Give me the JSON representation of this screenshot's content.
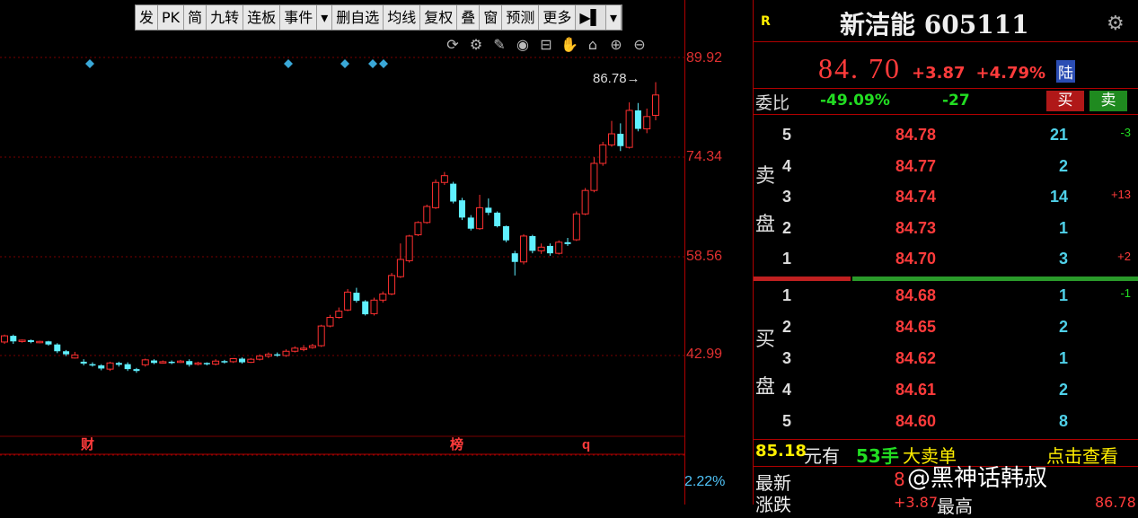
{
  "toolbar": {
    "items": [
      "发",
      "PK",
      "简",
      "九转",
      "连板",
      "事件",
      "▾",
      "删自选",
      "均线",
      "复权",
      "叠",
      "窗",
      "预测",
      "更多",
      "▶▌",
      "▾"
    ]
  },
  "chart_icons": [
    "refresh-icon",
    "gear-icon",
    "pen-icon",
    "eye-icon",
    "lock-icon",
    "hand-icon",
    "lock-icon",
    "zoom-in-icon",
    "zoom-out-icon"
  ],
  "chart": {
    "y_labels": [
      "89.92",
      "74.34",
      "58.56",
      "42.99"
    ],
    "high_label": "86.78",
    "event_markers": [
      "财",
      "榜",
      "q"
    ],
    "volume_pct": "2.22%"
  },
  "chart_data": {
    "type": "candlestick",
    "ylim": [
      30,
      95
    ],
    "candles": [
      [
        44.6,
        45.6,
        44.3,
        45.8
      ],
      [
        45.6,
        44.7,
        44.3,
        45.8
      ],
      [
        44.7,
        44.9,
        44.5,
        45.0
      ],
      [
        44.9,
        44.6,
        44.4,
        45.0
      ],
      [
        44.6,
        44.7,
        44.4,
        44.8
      ],
      [
        44.7,
        44.2,
        44.0,
        44.8
      ],
      [
        44.2,
        43.1,
        42.8,
        44.4
      ],
      [
        43.1,
        42.6,
        42.3,
        43.3
      ],
      [
        42.0,
        42.5,
        41.9,
        43.0
      ],
      [
        41.4,
        41.1,
        40.8,
        41.8
      ],
      [
        41.0,
        40.9,
        40.6,
        41.3
      ],
      [
        40.8,
        40.3,
        40.0,
        41.0
      ],
      [
        40.2,
        41.2,
        39.9,
        41.4
      ],
      [
        41.2,
        40.9,
        40.6,
        41.4
      ],
      [
        41.0,
        40.2,
        39.9,
        41.3
      ],
      [
        40.2,
        39.9,
        39.6,
        40.4
      ],
      [
        40.9,
        41.7,
        40.6,
        41.9
      ],
      [
        41.6,
        41.2,
        41.0,
        41.8
      ],
      [
        41.3,
        41.4,
        41.1,
        41.6
      ],
      [
        41.4,
        41.3,
        41.0,
        41.6
      ],
      [
        41.3,
        41.5,
        41.2,
        41.7
      ],
      [
        41.5,
        40.9,
        40.6,
        41.8
      ],
      [
        41.0,
        41.2,
        40.8,
        41.4
      ],
      [
        41.2,
        41.0,
        40.8,
        41.3
      ],
      [
        41.0,
        41.5,
        40.8,
        41.8
      ],
      [
        41.5,
        41.4,
        41.1,
        41.7
      ],
      [
        41.4,
        41.9,
        41.2,
        42.0
      ],
      [
        41.9,
        41.3,
        41.1,
        42.1
      ],
      [
        41.3,
        41.8,
        41.2,
        42.0
      ],
      [
        41.8,
        42.3,
        41.6,
        42.6
      ],
      [
        42.3,
        42.6,
        42.0,
        42.9
      ],
      [
        42.6,
        42.4,
        42.2,
        42.9
      ],
      [
        42.4,
        43.1,
        42.2,
        43.4
      ],
      [
        43.1,
        43.6,
        42.9,
        43.9
      ],
      [
        43.4,
        43.6,
        43.1,
        44.1
      ],
      [
        43.7,
        44.0,
        43.5,
        44.3
      ],
      [
        44.0,
        47.2,
        43.8,
        47.4
      ],
      [
        47.2,
        48.6,
        47.0,
        49.0
      ],
      [
        48.6,
        49.6,
        48.4,
        50.2
      ],
      [
        49.8,
        52.7,
        49.6,
        53.2
      ],
      [
        52.6,
        51.3,
        51.0,
        53.4
      ],
      [
        51.2,
        49.1,
        48.9,
        51.4
      ],
      [
        49.2,
        51.4,
        48.9,
        51.8
      ],
      [
        51.4,
        52.4,
        51.0,
        52.8
      ],
      [
        52.4,
        55.4,
        52.2,
        55.8
      ],
      [
        55.2,
        58.0,
        55.0,
        60.6
      ],
      [
        57.8,
        61.8,
        57.5,
        62.0
      ],
      [
        62.0,
        64.0,
        61.8,
        64.2
      ],
      [
        64.0,
        66.6,
        63.8,
        66.9
      ],
      [
        66.4,
        70.5,
        66.2,
        71.0
      ],
      [
        70.5,
        71.6,
        70.1,
        72.2
      ],
      [
        70.3,
        67.4,
        67.1,
        70.6
      ],
      [
        67.6,
        64.8,
        64.4,
        68.0
      ],
      [
        64.8,
        63.0,
        62.7,
        65.2
      ],
      [
        63.0,
        66.4,
        62.8,
        68.5
      ],
      [
        66.4,
        65.6,
        65.2,
        67.9
      ],
      [
        65.6,
        63.4,
        63.2,
        65.8
      ],
      [
        63.4,
        61.1,
        60.8,
        63.5
      ],
      [
        59.0,
        57.6,
        55.4,
        59.4
      ],
      [
        57.6,
        61.8,
        57.2,
        62.1
      ],
      [
        61.8,
        59.4,
        59.0,
        62.0
      ],
      [
        59.4,
        60.0,
        58.9,
        60.6
      ],
      [
        60.2,
        59.0,
        58.6,
        60.6
      ],
      [
        59.0,
        60.8,
        58.8,
        61.1
      ],
      [
        60.8,
        60.5,
        60.2,
        61.5
      ],
      [
        61.2,
        65.4,
        61.0,
        65.8
      ],
      [
        65.4,
        69.2,
        65.2,
        69.6
      ],
      [
        69.2,
        73.6,
        68.9,
        74.6
      ],
      [
        73.6,
        76.6,
        73.2,
        77.1
      ],
      [
        76.6,
        78.4,
        76.3,
        80.5
      ],
      [
        78.4,
        76.4,
        75.6,
        80.1
      ],
      [
        76.2,
        82.2,
        76.0,
        83.5
      ],
      [
        82.2,
        79.2,
        78.8,
        83.4
      ],
      [
        79.2,
        81.2,
        78.5,
        82.5
      ],
      [
        81.4,
        84.7,
        80.6,
        86.78
      ]
    ]
  },
  "quote": {
    "badge": "R",
    "name": "新洁能 605111",
    "price": "84. 70",
    "change": "+3.87",
    "change_pct": "+4.79%",
    "market": "陆"
  },
  "webi": {
    "label": "委比",
    "ratio": "-49.09%",
    "diff": "-27",
    "buy_label": "买",
    "sell_label": "卖"
  },
  "sell_side": {
    "label1": "卖",
    "label2": "盘",
    "rows": [
      {
        "lvl": "5",
        "price": "84.78",
        "vol": "21",
        "d": "-3",
        "dc": "green"
      },
      {
        "lvl": "4",
        "price": "84.77",
        "vol": "2",
        "d": "",
        "dc": ""
      },
      {
        "lvl": "3",
        "price": "84.74",
        "vol": "14",
        "d": "+13",
        "dc": "red"
      },
      {
        "lvl": "2",
        "price": "84.73",
        "vol": "1",
        "d": "",
        "dc": ""
      },
      {
        "lvl": "1",
        "price": "84.70",
        "vol": "3",
        "d": "+2",
        "dc": "red"
      }
    ]
  },
  "buy_side": {
    "label1": "买",
    "label2": "盘",
    "rows": [
      {
        "lvl": "1",
        "price": "84.68",
        "vol": "1",
        "d": "-1",
        "dc": "green"
      },
      {
        "lvl": "2",
        "price": "84.65",
        "vol": "2",
        "d": "",
        "dc": ""
      },
      {
        "lvl": "3",
        "price": "84.62",
        "vol": "1",
        "d": "",
        "dc": ""
      },
      {
        "lvl": "4",
        "price": "84.61",
        "vol": "2",
        "d": "",
        "dc": ""
      },
      {
        "lvl": "5",
        "price": "84.60",
        "vol": "8",
        "d": "",
        "dc": ""
      }
    ]
  },
  "big_order": {
    "price": "85.18",
    "t1": "元有",
    "qty": "53手",
    "t2": "大卖单",
    "link": "点击查看"
  },
  "bottom": {
    "latest_label": "最新",
    "rise_label": "涨跌",
    "partial1": "8",
    "partial2": "+3.87",
    "label_high": "最高",
    "partial3": "86.78"
  },
  "watermark": "@黑神话韩叔"
}
